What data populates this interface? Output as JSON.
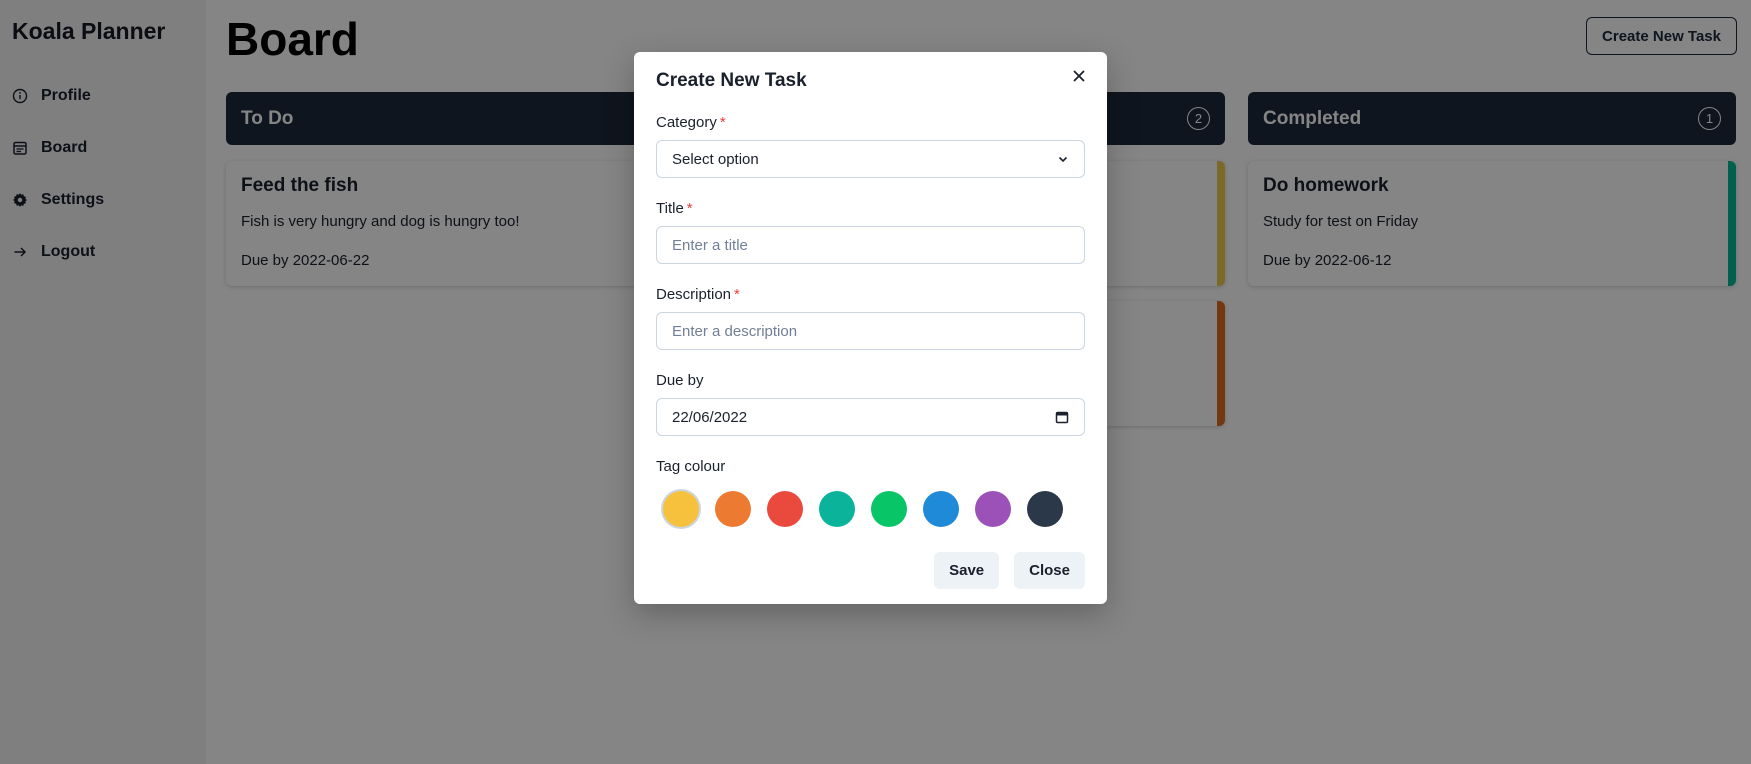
{
  "sidebar": {
    "app_title": "Koala Planner",
    "items": [
      {
        "label": "Profile",
        "icon": "info-circle-icon"
      },
      {
        "label": "Board",
        "icon": "calendar-icon"
      },
      {
        "label": "Settings",
        "icon": "gear-icon"
      },
      {
        "label": "Logout",
        "icon": "arrow-right-icon"
      }
    ]
  },
  "header": {
    "title": "Board",
    "create_button_label": "Create New Task"
  },
  "columns": [
    {
      "name": "To Do",
      "count": "",
      "cards": [
        {
          "title": "Feed the fish",
          "description": "Fish is very hungry and dog is hungry too!",
          "due": "Due by 2022-06-22",
          "tag_color": ""
        }
      ]
    },
    {
      "name": "",
      "count": "2",
      "cards": [
        {
          "title": "",
          "description": "",
          "due": "",
          "tag_color": "#ecc94b"
        },
        {
          "title": "",
          "description": "",
          "due": "",
          "tag_color": "#dd6b20"
        }
      ]
    },
    {
      "name": "Completed",
      "count": "1",
      "cards": [
        {
          "title": "Do homework",
          "description": "Study for test on Friday",
          "due": "Due by 2022-06-12",
          "tag_color": "#00b894"
        }
      ]
    }
  ],
  "modal": {
    "title": "Create New Task",
    "category": {
      "label": "Category",
      "value": "Select option"
    },
    "title_field": {
      "label": "Title",
      "placeholder": "Enter a title"
    },
    "description_field": {
      "label": "Description",
      "placeholder": "Enter a description"
    },
    "due_field": {
      "label": "Due by",
      "value": "22/06/2022"
    },
    "tag_colour_label": "Tag colour",
    "tag_colours": [
      "#f6c23e",
      "#ed7a31",
      "#ea4a3d",
      "#0bb39b",
      "#08c567",
      "#1f8ad7",
      "#9b51b8",
      "#2a3849"
    ],
    "selected_colour_index": 0,
    "save_label": "Save",
    "close_label": "Close",
    "required_mark": "*"
  },
  "colors": {
    "column_header_bg": "#1e293b",
    "overlay": "rgba(0,0,0,0.48)"
  }
}
